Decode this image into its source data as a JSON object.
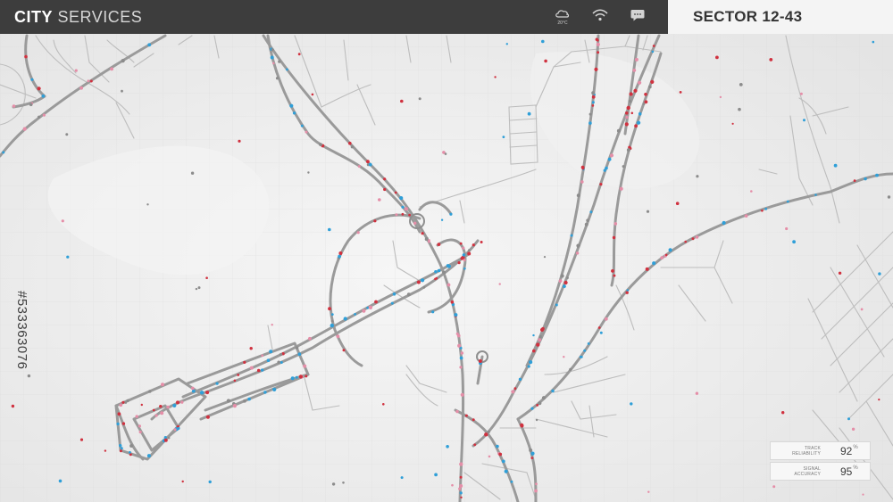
{
  "header": {
    "brand_strong": "CITY",
    "brand_light": "SERVICES",
    "sector": "SECTOR 12-43",
    "weather_temp": "20°C",
    "icons": [
      "weather-icon",
      "wifi-icon",
      "chat-icon"
    ]
  },
  "watermark": {
    "id": "#533363076"
  },
  "stats": [
    {
      "label_line1": "TRACK",
      "label_line2": "RELIABILITY",
      "value": "92",
      "unit": "%"
    },
    {
      "label_line1": "SIGNAL",
      "label_line2": "ACCURACY",
      "value": "95",
      "unit": "%"
    }
  ],
  "colors": {
    "road": "#9a9a9a",
    "minor_road": "#b9b9b9",
    "header_bg": "#3d3d3d",
    "dot_red": "#d0313f",
    "dot_blue": "#2f9fd8",
    "dot_pink": "#e58ea8",
    "dot_gray": "#8c8c8c"
  }
}
